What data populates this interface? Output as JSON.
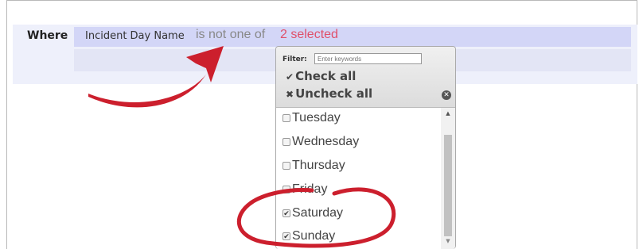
{
  "condition": {
    "where_label": "Where",
    "field_name": "Incident Day Name",
    "operator": "is not one of",
    "selected_summary": "2 selected"
  },
  "dropdown": {
    "filter_label": "Filter:",
    "filter_placeholder": "Enter keywords",
    "check_all": "Check all",
    "uncheck_all": "Uncheck all",
    "options": [
      {
        "label": "Tuesday",
        "checked": false
      },
      {
        "label": "Wednesday",
        "checked": false
      },
      {
        "label": "Thursday",
        "checked": false
      },
      {
        "label": "Friday",
        "checked": false
      },
      {
        "label": "Saturday",
        "checked": true
      },
      {
        "label": "Sunday",
        "checked": true
      }
    ]
  },
  "colors": {
    "accent_pink": "#e0506a",
    "annotation_red": "#cc1f2d",
    "row_highlight": "#d3d6f7"
  }
}
